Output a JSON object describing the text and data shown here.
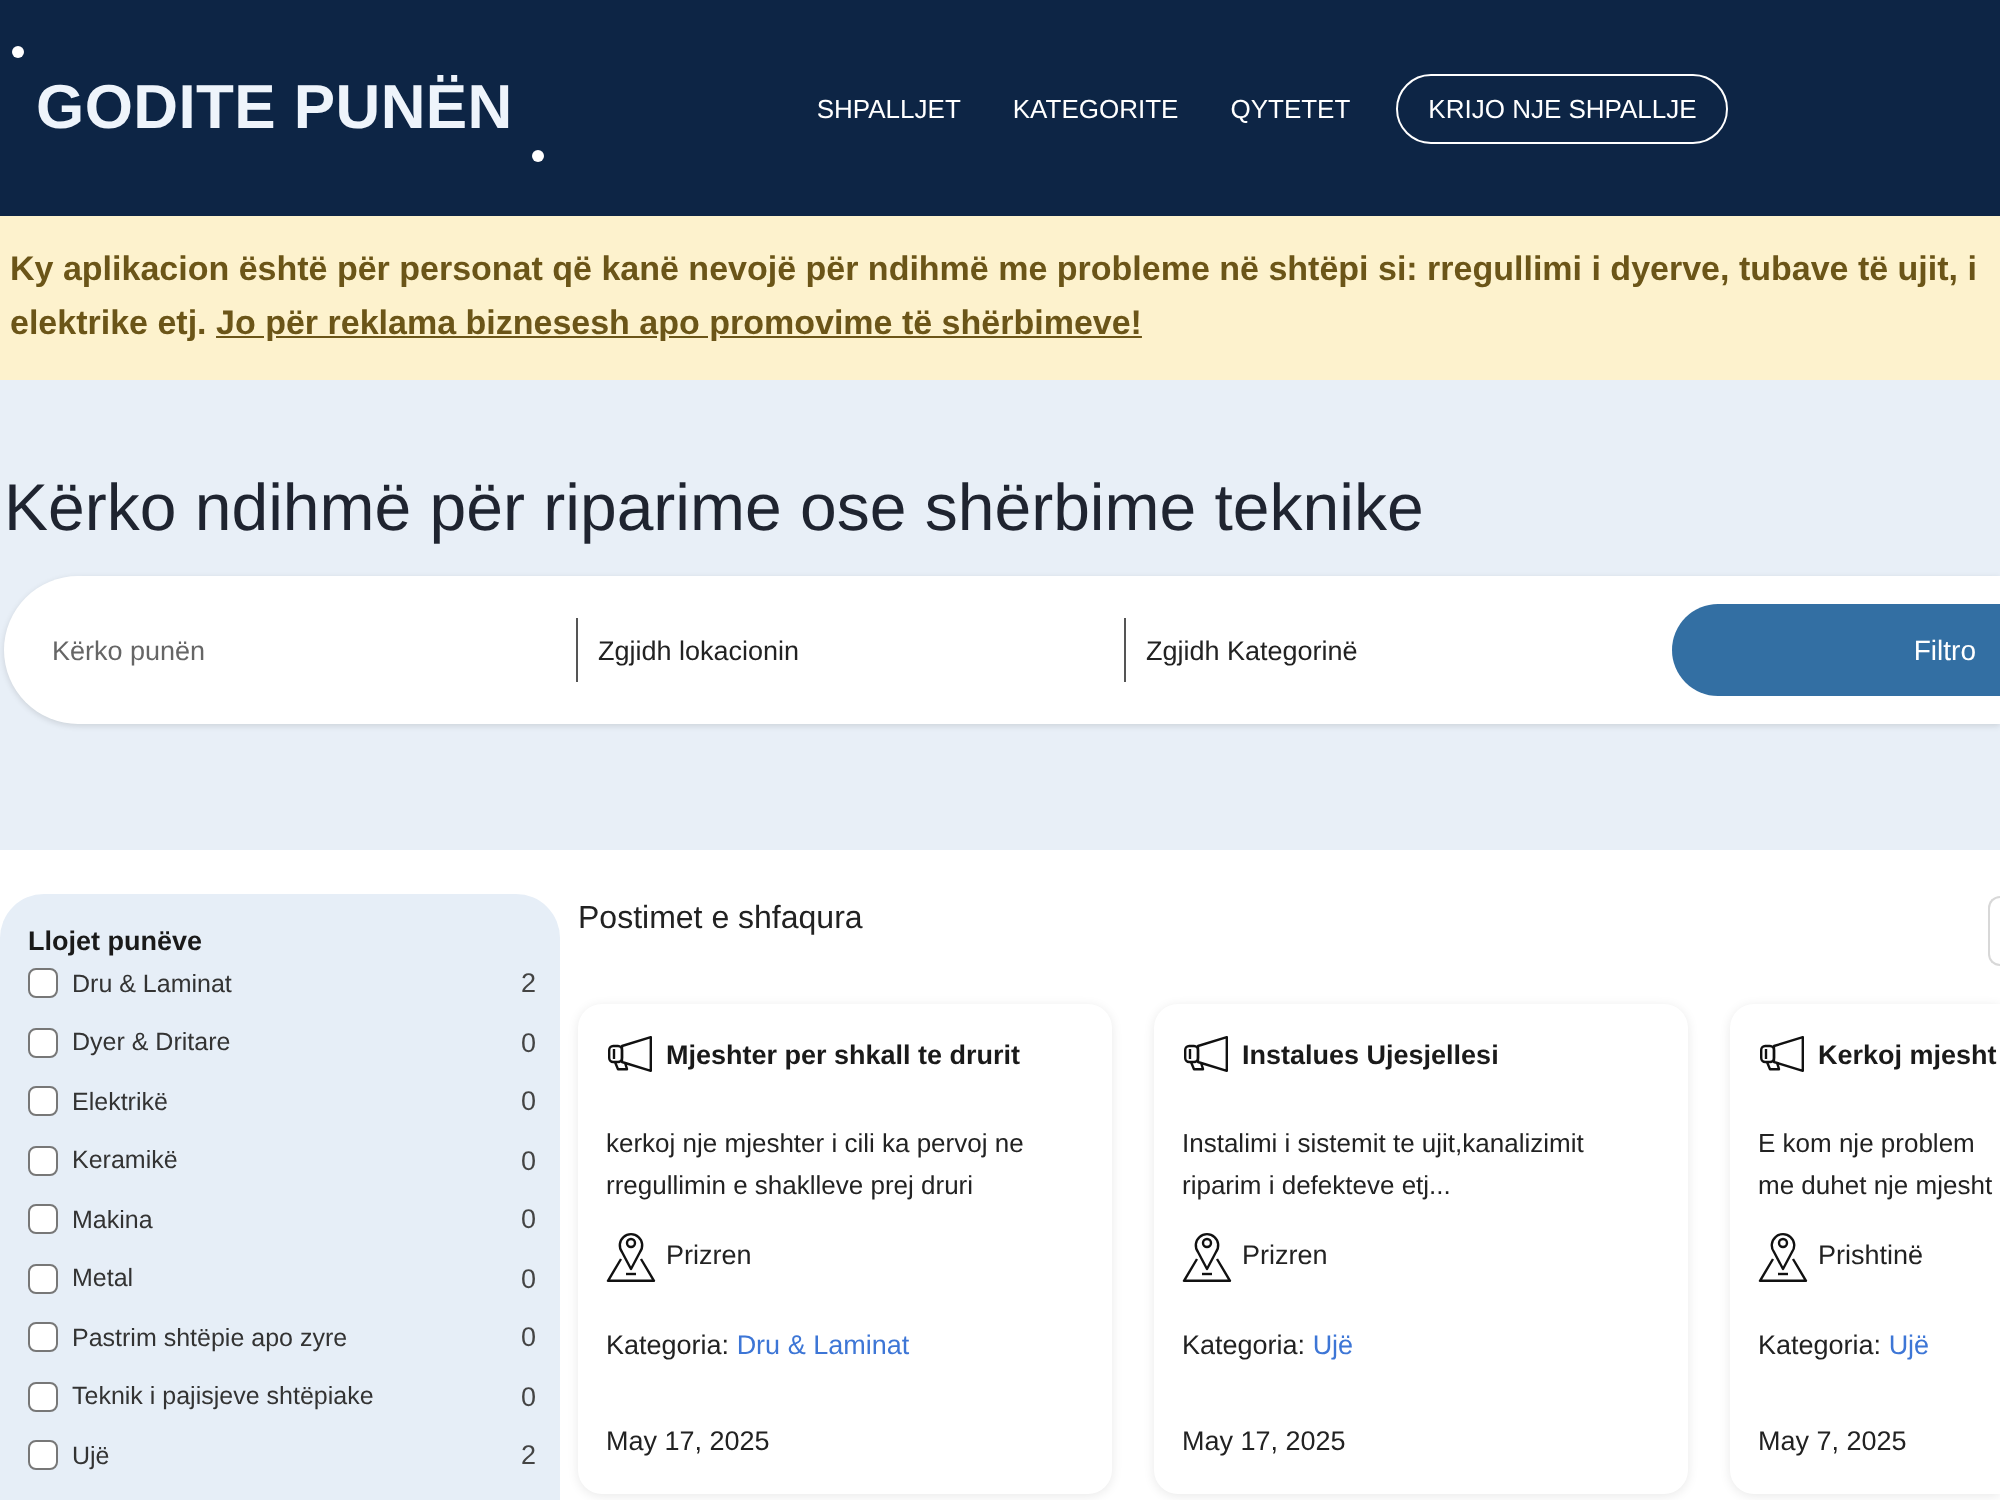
{
  "header": {
    "logo": "GODITE PUNËN",
    "nav": [
      "SHPALLJET",
      "KATEGORITE",
      "QYTETET"
    ],
    "cta": "KRIJO NJE SHPALLJE"
  },
  "notice": {
    "line_1": "Ky aplikacion është për personat që kanë nevojë për ndihmë me probleme në shtëpi si: rregullimi i dyerve, tubave të ujit, i",
    "line_2": "elektrike etj.",
    "link": "Jo për reklama biznesesh apo promovime të shërbimeve!"
  },
  "hero": {
    "title": "Kërko ndihmë për riparime ose shërbime teknike",
    "search": {
      "keyword": {
        "placeholder": "Kërko punën"
      },
      "location": {
        "value": "Zgjidh lokacionin"
      },
      "category": {
        "value": "Zgjidh Kategorinë"
      },
      "button": "Filtro"
    }
  },
  "sidebar": {
    "title": "Llojet punëve",
    "items": [
      {
        "label": "Dru & Laminat",
        "count": "2",
        "checked": false
      },
      {
        "label": "Dyer & Dritare",
        "count": "0",
        "checked": false
      },
      {
        "label": "Elektrikë",
        "count": "0",
        "checked": false
      },
      {
        "label": "Keramikë",
        "count": "0",
        "checked": false
      },
      {
        "label": "Makina",
        "count": "0",
        "checked": false
      },
      {
        "label": "Metal",
        "count": "0",
        "checked": false
      },
      {
        "label": "Pastrim shtëpie apo zyre",
        "count": "0",
        "checked": false
      },
      {
        "label": "Teknik i pajisjeve shtëpiake",
        "count": "0",
        "checked": false
      },
      {
        "label": "Ujë",
        "count": "2",
        "checked": false
      }
    ]
  },
  "posts": {
    "title": "Postimet e shfaqura",
    "cards": [
      {
        "title": "Mjeshter per shkall te drurit",
        "description": [
          "kerkoj nje mjeshter i cili ka pervoj ne",
          "rregullimin e shaklleve prej druri"
        ],
        "city": "Prizren",
        "category_label": "Kategoria:",
        "category": "Dru & Laminat",
        "date": "May 17, 2025"
      },
      {
        "title": "Instalues Ujesjellesi",
        "description": [
          "Instalimi i sistemit te ujit,kanalizimit",
          "riparim i defekteve etj..."
        ],
        "city": "Prizren",
        "category_label": "Kategoria:",
        "category": "Ujë",
        "date": "May 17, 2025"
      },
      {
        "title": "Kerkoj mjesht",
        "description": [
          "E kom nje problem",
          "me duhet nje mjesht"
        ],
        "city": "Prishtinë",
        "category_label": "Kategoria:",
        "category": "Ujë",
        "date": "May 7, 2025"
      }
    ]
  }
}
